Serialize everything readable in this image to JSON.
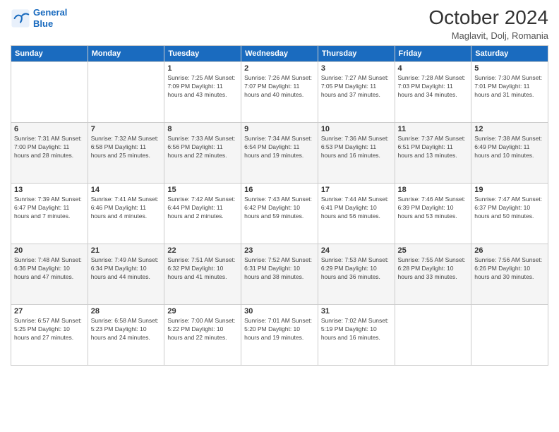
{
  "logo": {
    "line1": "General",
    "line2": "Blue"
  },
  "header": {
    "month": "October 2024",
    "location": "Maglavit, Dolj, Romania"
  },
  "weekdays": [
    "Sunday",
    "Monday",
    "Tuesday",
    "Wednesday",
    "Thursday",
    "Friday",
    "Saturday"
  ],
  "weeks": [
    [
      {
        "day": "",
        "info": ""
      },
      {
        "day": "",
        "info": ""
      },
      {
        "day": "1",
        "info": "Sunrise: 7:25 AM\nSunset: 7:09 PM\nDaylight: 11 hours\nand 43 minutes."
      },
      {
        "day": "2",
        "info": "Sunrise: 7:26 AM\nSunset: 7:07 PM\nDaylight: 11 hours\nand 40 minutes."
      },
      {
        "day": "3",
        "info": "Sunrise: 7:27 AM\nSunset: 7:05 PM\nDaylight: 11 hours\nand 37 minutes."
      },
      {
        "day": "4",
        "info": "Sunrise: 7:28 AM\nSunset: 7:03 PM\nDaylight: 11 hours\nand 34 minutes."
      },
      {
        "day": "5",
        "info": "Sunrise: 7:30 AM\nSunset: 7:01 PM\nDaylight: 11 hours\nand 31 minutes."
      }
    ],
    [
      {
        "day": "6",
        "info": "Sunrise: 7:31 AM\nSunset: 7:00 PM\nDaylight: 11 hours\nand 28 minutes."
      },
      {
        "day": "7",
        "info": "Sunrise: 7:32 AM\nSunset: 6:58 PM\nDaylight: 11 hours\nand 25 minutes."
      },
      {
        "day": "8",
        "info": "Sunrise: 7:33 AM\nSunset: 6:56 PM\nDaylight: 11 hours\nand 22 minutes."
      },
      {
        "day": "9",
        "info": "Sunrise: 7:34 AM\nSunset: 6:54 PM\nDaylight: 11 hours\nand 19 minutes."
      },
      {
        "day": "10",
        "info": "Sunrise: 7:36 AM\nSunset: 6:53 PM\nDaylight: 11 hours\nand 16 minutes."
      },
      {
        "day": "11",
        "info": "Sunrise: 7:37 AM\nSunset: 6:51 PM\nDaylight: 11 hours\nand 13 minutes."
      },
      {
        "day": "12",
        "info": "Sunrise: 7:38 AM\nSunset: 6:49 PM\nDaylight: 11 hours\nand 10 minutes."
      }
    ],
    [
      {
        "day": "13",
        "info": "Sunrise: 7:39 AM\nSunset: 6:47 PM\nDaylight: 11 hours\nand 7 minutes."
      },
      {
        "day": "14",
        "info": "Sunrise: 7:41 AM\nSunset: 6:46 PM\nDaylight: 11 hours\nand 4 minutes."
      },
      {
        "day": "15",
        "info": "Sunrise: 7:42 AM\nSunset: 6:44 PM\nDaylight: 11 hours\nand 2 minutes."
      },
      {
        "day": "16",
        "info": "Sunrise: 7:43 AM\nSunset: 6:42 PM\nDaylight: 10 hours\nand 59 minutes."
      },
      {
        "day": "17",
        "info": "Sunrise: 7:44 AM\nSunset: 6:41 PM\nDaylight: 10 hours\nand 56 minutes."
      },
      {
        "day": "18",
        "info": "Sunrise: 7:46 AM\nSunset: 6:39 PM\nDaylight: 10 hours\nand 53 minutes."
      },
      {
        "day": "19",
        "info": "Sunrise: 7:47 AM\nSunset: 6:37 PM\nDaylight: 10 hours\nand 50 minutes."
      }
    ],
    [
      {
        "day": "20",
        "info": "Sunrise: 7:48 AM\nSunset: 6:36 PM\nDaylight: 10 hours\nand 47 minutes."
      },
      {
        "day": "21",
        "info": "Sunrise: 7:49 AM\nSunset: 6:34 PM\nDaylight: 10 hours\nand 44 minutes."
      },
      {
        "day": "22",
        "info": "Sunrise: 7:51 AM\nSunset: 6:32 PM\nDaylight: 10 hours\nand 41 minutes."
      },
      {
        "day": "23",
        "info": "Sunrise: 7:52 AM\nSunset: 6:31 PM\nDaylight: 10 hours\nand 38 minutes."
      },
      {
        "day": "24",
        "info": "Sunrise: 7:53 AM\nSunset: 6:29 PM\nDaylight: 10 hours\nand 36 minutes."
      },
      {
        "day": "25",
        "info": "Sunrise: 7:55 AM\nSunset: 6:28 PM\nDaylight: 10 hours\nand 33 minutes."
      },
      {
        "day": "26",
        "info": "Sunrise: 7:56 AM\nSunset: 6:26 PM\nDaylight: 10 hours\nand 30 minutes."
      }
    ],
    [
      {
        "day": "27",
        "info": "Sunrise: 6:57 AM\nSunset: 5:25 PM\nDaylight: 10 hours\nand 27 minutes."
      },
      {
        "day": "28",
        "info": "Sunrise: 6:58 AM\nSunset: 5:23 PM\nDaylight: 10 hours\nand 24 minutes."
      },
      {
        "day": "29",
        "info": "Sunrise: 7:00 AM\nSunset: 5:22 PM\nDaylight: 10 hours\nand 22 minutes."
      },
      {
        "day": "30",
        "info": "Sunrise: 7:01 AM\nSunset: 5:20 PM\nDaylight: 10 hours\nand 19 minutes."
      },
      {
        "day": "31",
        "info": "Sunrise: 7:02 AM\nSunset: 5:19 PM\nDaylight: 10 hours\nand 16 minutes."
      },
      {
        "day": "",
        "info": ""
      },
      {
        "day": "",
        "info": ""
      }
    ]
  ]
}
